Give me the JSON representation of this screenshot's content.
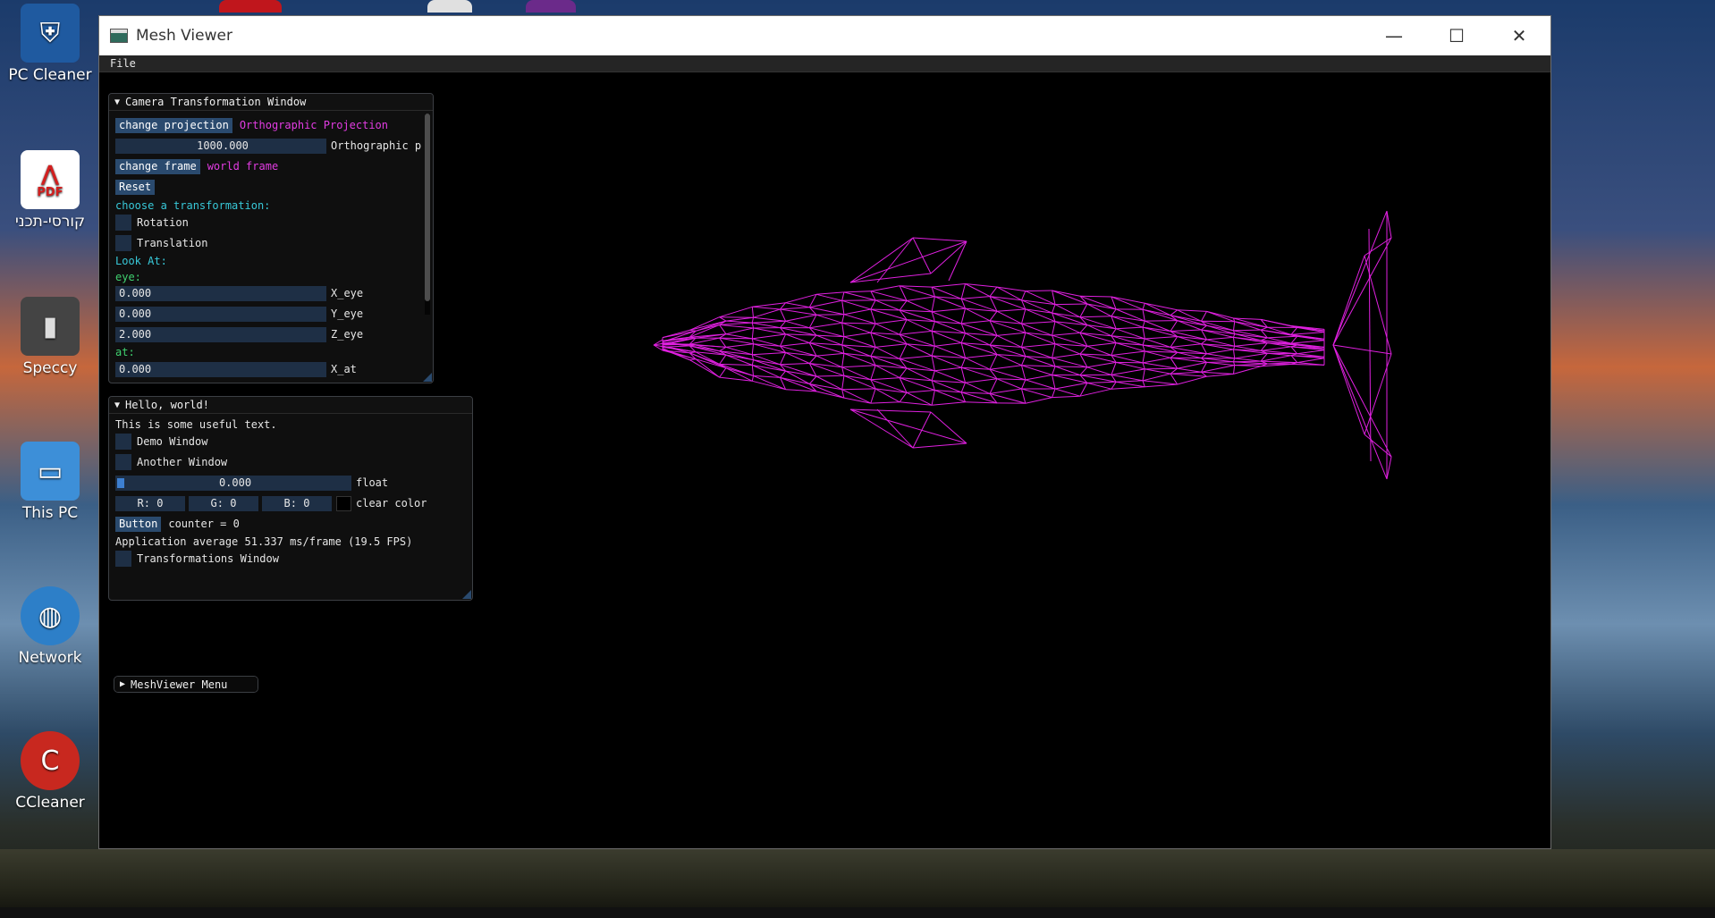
{
  "desktop": {
    "icons": [
      {
        "label": "PC Cleaner",
        "icon": "shield-icon",
        "color": "#2a6fb0"
      },
      {
        "label": "קורסי-תכני",
        "icon": "pdf-icon",
        "color": "#ffffff"
      },
      {
        "label": "Speccy",
        "icon": "computer-tower-icon",
        "color": "#3a3a3a"
      },
      {
        "label": "This PC",
        "icon": "monitor-icon",
        "color": "#3d8fd8"
      },
      {
        "label": "Network",
        "icon": "globe-icon",
        "color": "#3d8fd8"
      },
      {
        "label": "CCleaner",
        "icon": "broom-icon",
        "color": "#d8312c"
      }
    ],
    "pdf_badge": "PDF"
  },
  "window": {
    "title": "Mesh Viewer",
    "menu": [
      "File"
    ],
    "controls": {
      "minimize": "—",
      "maximize": "☐",
      "close": "✕"
    }
  },
  "camera_panel": {
    "title": "Camera Transformation Window",
    "change_projection_label": "change projection",
    "projection_value": "Orthographic Projection",
    "ortho_value": "1000.000",
    "ortho_label": "Orthographic p",
    "change_frame_label": "change frame",
    "frame_value": "world frame",
    "reset_label": "Reset",
    "choose_transformation": "choose a transformation:",
    "rotation_label": "Rotation",
    "translation_label": "Translation",
    "look_at": "Look At:",
    "eye_heading": "eye:",
    "x_eye_value": "0.000",
    "x_eye_label": "X_eye",
    "y_eye_value": "0.000",
    "y_eye_label": "Y_eye",
    "z_eye_value": "2.000",
    "z_eye_label": "Z_eye",
    "at_heading": "at:",
    "x_at_value": "0.000",
    "x_at_label": "X_at"
  },
  "hello_panel": {
    "title": "Hello, world!",
    "useful_text": "This is some useful text.",
    "demo_window_label": "Demo Window",
    "another_window_label": "Another Window",
    "float_value": "0.000",
    "float_label": "float",
    "r_label": "R:  0",
    "g_label": "G:  0",
    "b_label": "B:  0",
    "clear_color_label": "clear color",
    "button_label": "Button",
    "counter_text": "counter = 0",
    "fps_text": "Application average 51.337 ms/frame (19.5 FPS)",
    "transformations_window_label": "Transformations Window"
  },
  "menu_panel": {
    "title": "MeshViewer Menu"
  },
  "viewport": {
    "mesh_color": "#e020e0",
    "mesh_icon": "dolphin-wireframe"
  }
}
